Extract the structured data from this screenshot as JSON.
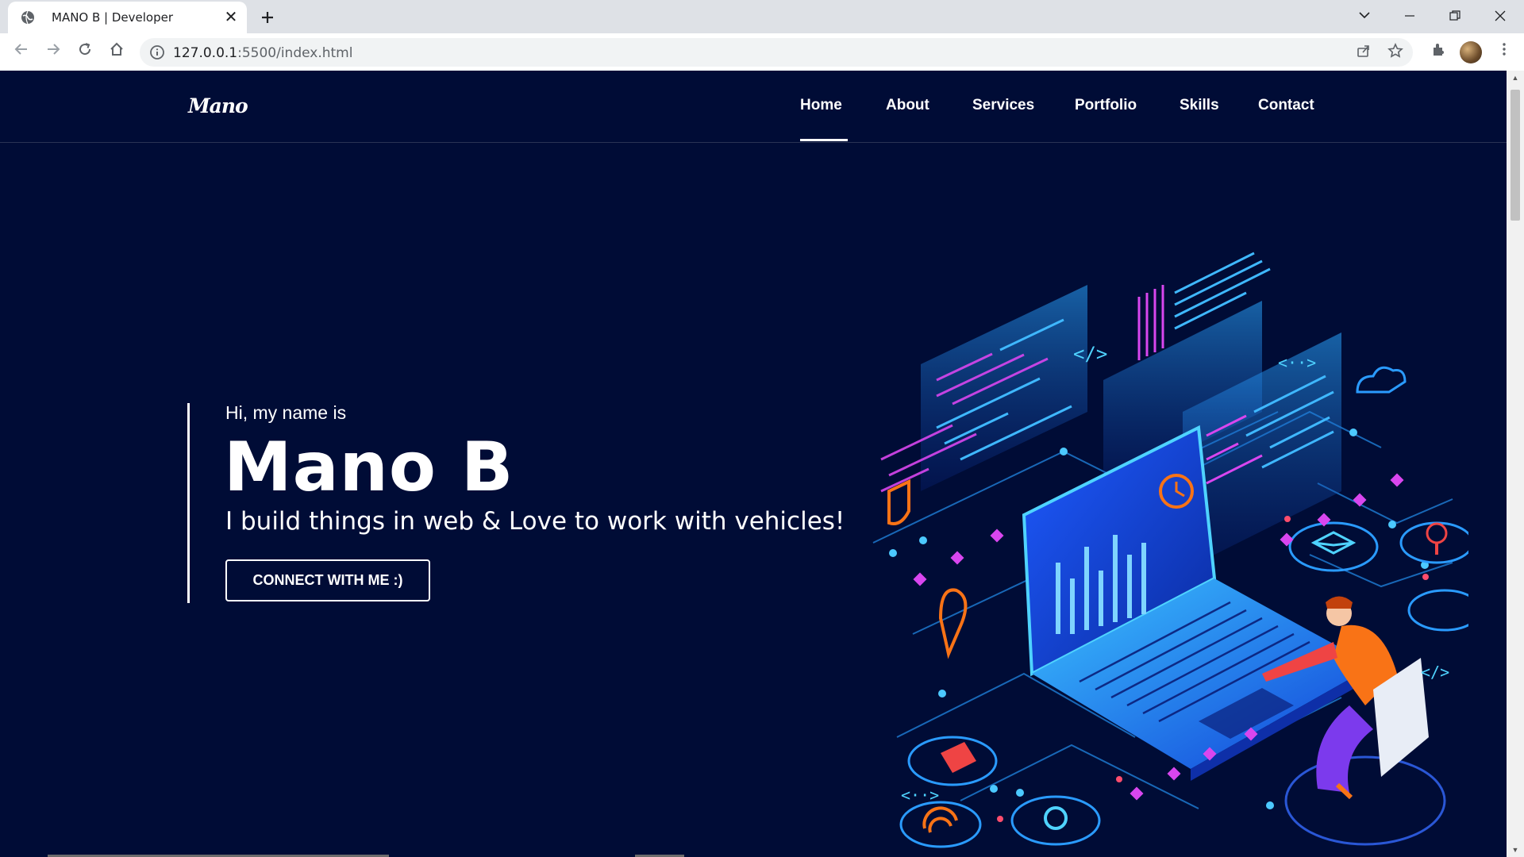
{
  "browser": {
    "tab_title": "MANO B | Developer",
    "url_host": "127.0.0.1",
    "url_rest": ":5500/index.html",
    "new_tab_label": "+"
  },
  "nav": {
    "logo": "Mano",
    "links": [
      "Home",
      "About",
      "Services",
      "Portfolio",
      "Skills",
      "Contact"
    ],
    "active": "Home"
  },
  "hero": {
    "greeting": "Hi, my name is",
    "name": "Mano B",
    "tagline": "I build things in web & Love to work with vehicles!",
    "cta_label": "CONNECT WITH ME :)"
  },
  "icons": {
    "tab": [
      "globe-icon",
      "close-icon",
      "plus-icon"
    ],
    "window": [
      "tab-search-icon",
      "minimize-icon",
      "restore-icon",
      "close-window-icon"
    ],
    "toolbar": [
      "back-icon",
      "forward-icon",
      "reload-icon",
      "home-icon",
      "info-icon",
      "share-icon",
      "star-icon",
      "extensions-icon",
      "profile-avatar",
      "menu-icon"
    ]
  },
  "colors": {
    "page_bg": "#000c36",
    "text": "#ffffff",
    "accent_cyan": "#3fb8ff",
    "accent_magenta": "#d946ef",
    "accent_orange": "#f97316"
  }
}
